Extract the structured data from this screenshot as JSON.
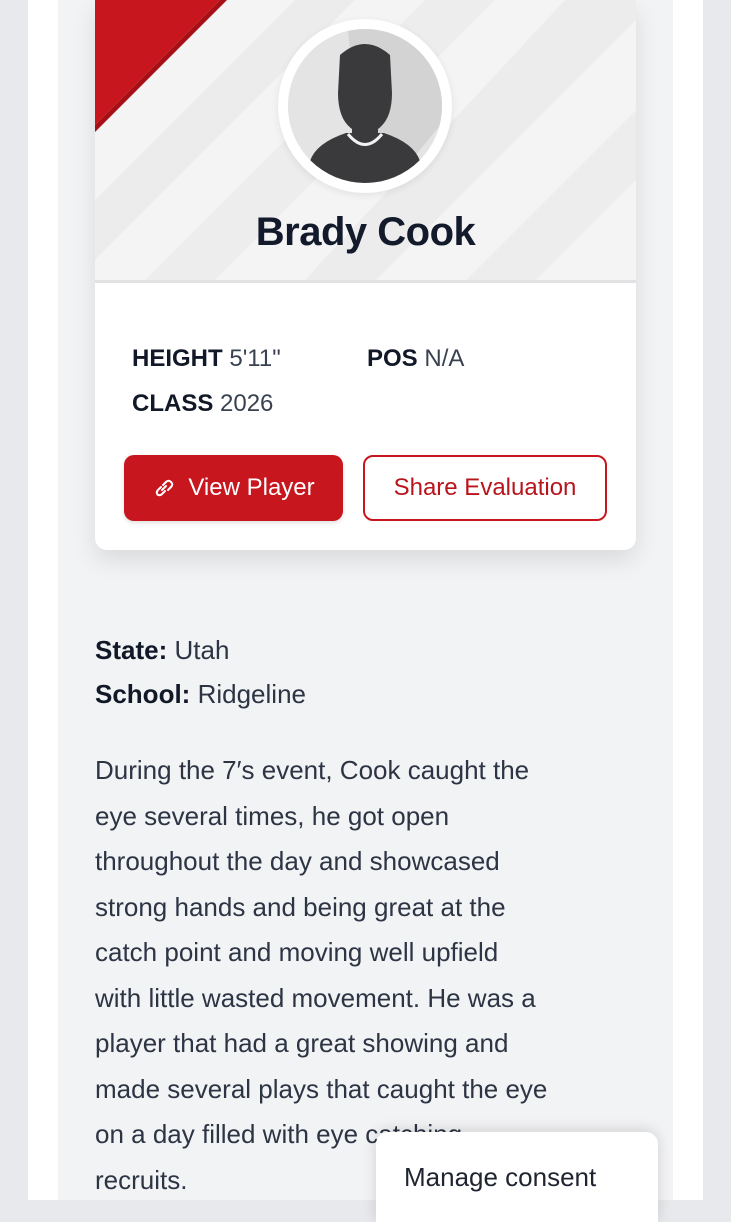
{
  "player": {
    "name": "Brady Cook",
    "stats": {
      "height_label": "HEIGHT",
      "height_value": "5'11\"",
      "pos_label": "POS",
      "pos_value": "N/A",
      "class_label": "CLASS",
      "class_value": "2026"
    }
  },
  "actions": {
    "view_player": "View Player",
    "share_evaluation": "Share Evaluation"
  },
  "details": {
    "state_label": "State:",
    "state_value": "Utah",
    "school_label": "School:",
    "school_value": "Ridgeline"
  },
  "evaluation": {
    "lines": [
      "During the 7′s event, Cook caught the",
      "eye several times, he got open",
      "throughout the day and showcased",
      "strong hands and being great at the",
      "catch point and moving well upfield",
      "with little wasted movement. He was a",
      "player that had a great showing and",
      "made several plays that caught the eye",
      "on a day filled with eye catching",
      "recruits."
    ]
  },
  "consent": {
    "label": "Manage consent"
  },
  "colors": {
    "accent": "#c8161e",
    "name_text": "#131a2b",
    "panel_bg": "#f2f3f5"
  },
  "icons": {
    "link": "link-icon",
    "avatar": "person-silhouette-icon"
  }
}
